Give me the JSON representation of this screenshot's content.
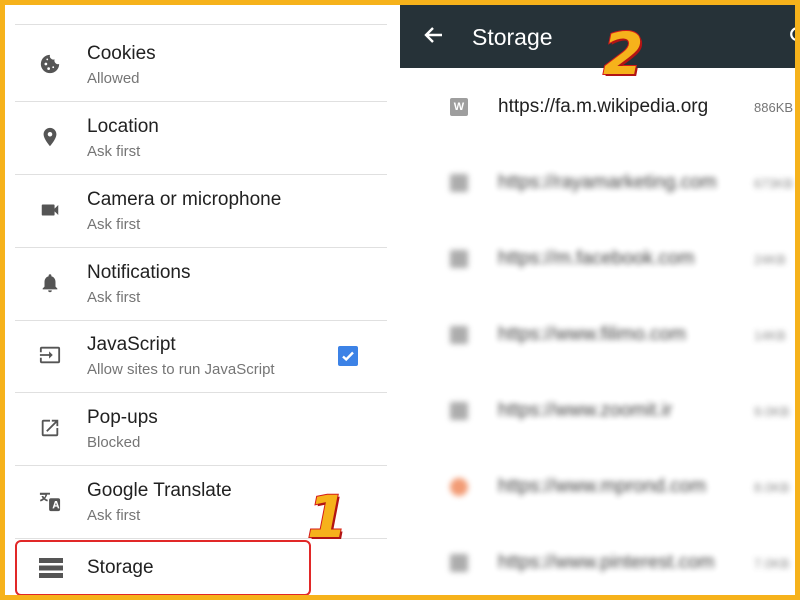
{
  "settings": {
    "items": [
      {
        "title": "Cookies",
        "subtitle": "Allowed",
        "icon": "cookie-icon"
      },
      {
        "title": "Location",
        "subtitle": "Ask first",
        "icon": "location-pin-icon"
      },
      {
        "title": "Camera or microphone",
        "subtitle": "Ask first",
        "icon": "videocam-icon"
      },
      {
        "title": "Notifications",
        "subtitle": "Ask first",
        "icon": "bell-icon"
      },
      {
        "title": "JavaScript",
        "subtitle": "Allow sites to run JavaScript",
        "icon": "javascript-icon",
        "checked": true
      },
      {
        "title": "Pop-ups",
        "subtitle": "Blocked",
        "icon": "open-in-new-icon"
      },
      {
        "title": "Google Translate",
        "subtitle": "Ask first",
        "icon": "translate-icon"
      }
    ],
    "storage": {
      "title": "Storage",
      "icon": "storage-icon"
    }
  },
  "annotations": {
    "step1": "1",
    "step2": "2",
    "color": "#f6b21b",
    "outline": "#e12828"
  },
  "storage_page": {
    "title": "Storage",
    "appbar_color": "#263238",
    "sites": [
      {
        "url": "https://fa.m.wikipedia.org",
        "size": "886KB",
        "favicon": "W"
      },
      {
        "url": "https://rayamarketing.com",
        "size": "673KB",
        "favicon": ""
      },
      {
        "url": "https://m.facebook.com",
        "size": "24KB",
        "favicon": ""
      },
      {
        "url": "https://www.filimo.com",
        "size": "14KB",
        "favicon": ""
      },
      {
        "url": "https://www.zoomit.ir",
        "size": "9.0KB",
        "favicon": ""
      },
      {
        "url": "https://www.mprond.com",
        "size": "8.0KB",
        "favicon": ""
      },
      {
        "url": "https://www.pinterest.com",
        "size": "7.0KB",
        "favicon": ""
      }
    ]
  }
}
